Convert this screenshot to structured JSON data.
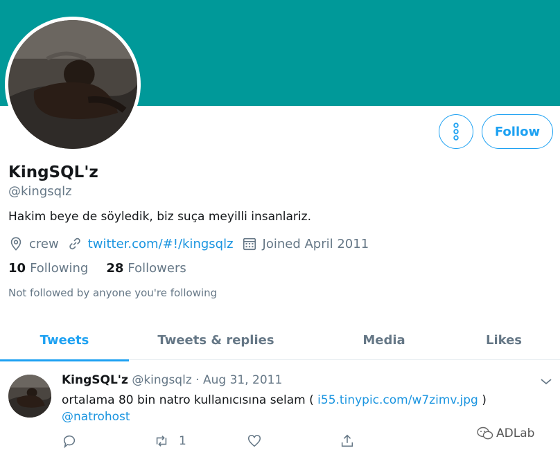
{
  "profile": {
    "name": "KingSQL'z",
    "handle": "@kingsqlz",
    "bio": "Hakim beye de söyledik, biz suça meyilli insanlariz.",
    "location": "crew",
    "website": "twitter.com/#!/kingsqlz",
    "joined": "Joined April 2011",
    "following_count": "10",
    "following_label": "Following",
    "followers_count": "28",
    "followers_label": "Followers",
    "not_followed_text": "Not followed by anyone you're following",
    "banner_color": "#009999"
  },
  "buttons": {
    "follow_label": "Follow",
    "more_icon": "more-vertical-icon"
  },
  "tabs": [
    {
      "label": "Tweets",
      "active": true
    },
    {
      "label": "Tweets & replies",
      "active": false
    },
    {
      "label": "Media",
      "active": false
    },
    {
      "label": "Likes",
      "active": false
    }
  ],
  "tweet": {
    "name": "KingSQL'z",
    "handle": "@kingsqlz",
    "separator": "·",
    "date": "Aug 31, 2011",
    "text_before": "ortalama 80 bin natro kullanıcısına selam ( ",
    "link": "i55.tinypic.com/w7zimv.jpg",
    "text_after": " )",
    "mention": "@natrohost",
    "retweet_count": "1"
  },
  "watermark": {
    "text": "ADLab"
  },
  "colors": {
    "accent": "#1da1f2",
    "link": "#1b95e0",
    "muted": "#657786"
  }
}
